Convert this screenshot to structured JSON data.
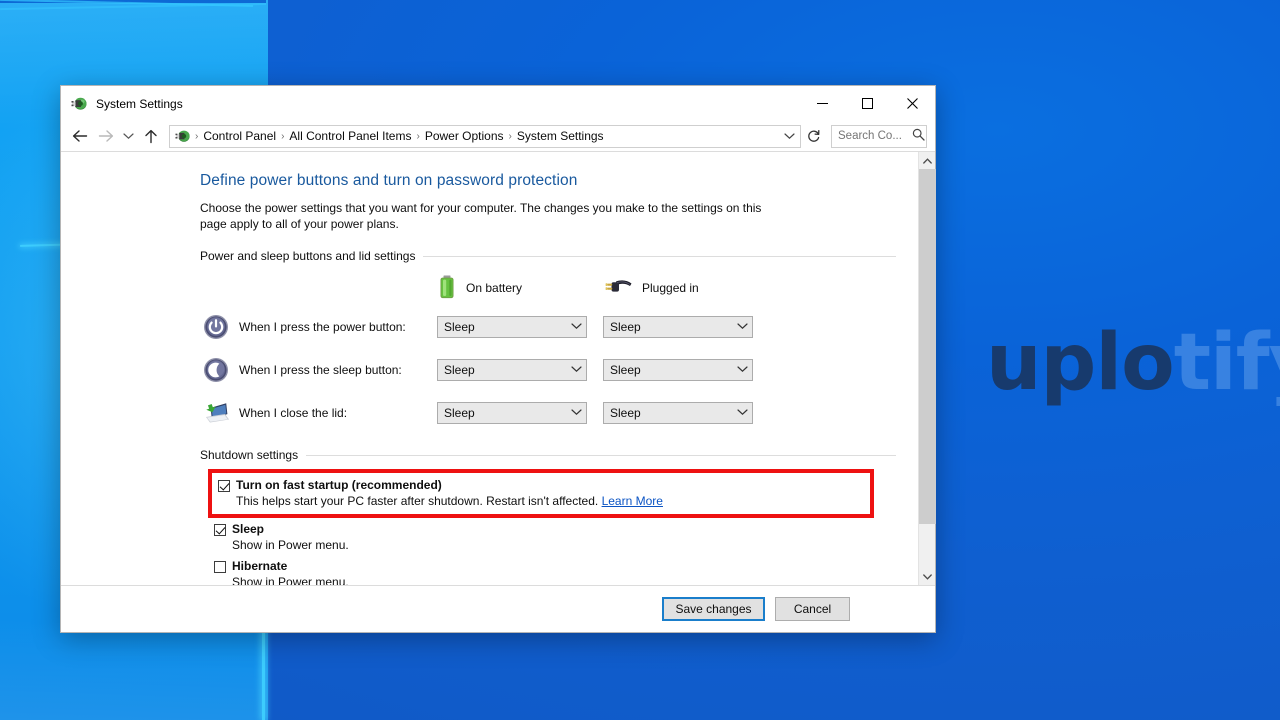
{
  "desktop": {
    "watermark_dark": "uplo",
    "watermark_light": "tify"
  },
  "window": {
    "title": "System Settings",
    "icon": "power-options-icon",
    "controls": {
      "minimize": "minimize-icon",
      "maximize": "maximize-icon",
      "close": "close-icon"
    }
  },
  "addressbar": {
    "back": "back-arrow-icon",
    "forward": "forward-arrow-icon",
    "recent": "chevron-down-icon",
    "up": "up-arrow-icon",
    "breadcrumbs": [
      "Control Panel",
      "All Control Panel Items",
      "Power Options",
      "System Settings"
    ],
    "separator": "›",
    "dropdown": "chevron-down-icon",
    "refresh": "refresh-icon",
    "search": {
      "value": "",
      "placeholder": "Search Co...",
      "icon": "search-icon"
    }
  },
  "page": {
    "title": "Define power buttons and turn on password protection",
    "description": "Choose the power settings that you want for your computer. The changes you make to the settings on this page apply to all of your power plans."
  },
  "groups": {
    "power_sleep_lid": "Power and sleep buttons and lid settings",
    "shutdown": "Shutdown settings"
  },
  "columns": [
    {
      "label": "On battery",
      "icon": "battery-icon"
    },
    {
      "label": "Plugged in",
      "icon": "power-plug-icon"
    }
  ],
  "rows": [
    {
      "icon": "power-button-icon",
      "label": "When I press the power button:",
      "battery": "Sleep",
      "plugged": "Sleep"
    },
    {
      "icon": "sleep-button-icon",
      "label": "When I press the sleep button:",
      "battery": "Sleep",
      "plugged": "Sleep"
    },
    {
      "icon": "laptop-lid-icon",
      "label": "When I close the lid:",
      "battery": "Sleep",
      "plugged": "Sleep"
    }
  ],
  "shutdown_options": [
    {
      "title": "Turn on fast startup (recommended)",
      "checked": true,
      "description": "This helps start your PC faster after shutdown. Restart isn't affected.",
      "link": "Learn More",
      "highlighted": true
    },
    {
      "title": "Sleep",
      "checked": true,
      "description": "Show in Power menu.",
      "link": "",
      "highlighted": false
    },
    {
      "title": "Hibernate",
      "checked": false,
      "description": "Show in Power menu.",
      "link": "",
      "highlighted": false
    }
  ],
  "footer": {
    "save": "Save changes",
    "cancel": "Cancel"
  },
  "scrollbar": {
    "up": "scroll-up-icon",
    "down": "scroll-down-icon"
  },
  "colors": {
    "heading": "#19599e",
    "link": "#0b54c4",
    "highlight": "#ee1111",
    "accent": "#1a7ecb"
  }
}
